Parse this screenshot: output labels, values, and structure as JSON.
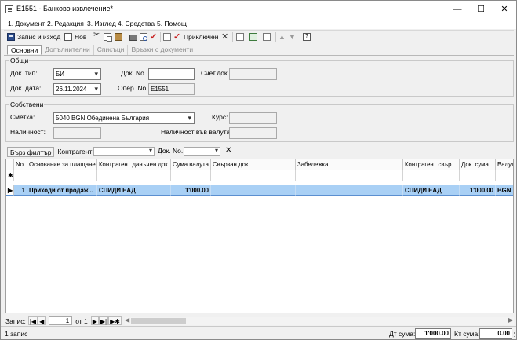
{
  "window": {
    "title": "E1551 - Банково извлечение*",
    "min": "—",
    "max": "☐",
    "close": "✕"
  },
  "menu": [
    "1. Документ",
    "2. Редакция",
    "3. Изглед",
    "4. Средства",
    "5. Помощ"
  ],
  "toolbar": {
    "save_label": "Запис и изход",
    "new_label": "Нов",
    "finish_label": "Приключен"
  },
  "tabs": [
    "Основни",
    "Допълнителни",
    "Списъци",
    "Връзки с документи"
  ],
  "general": {
    "title": "Общи",
    "doc_type_label": "Док. тип:",
    "doc_type_value": "БИ",
    "doc_no_label": "Док. No.",
    "doc_no_value": "",
    "account_doc_label": "Счет.док.",
    "account_doc_value": "",
    "doc_date_label": "Док. дата:",
    "doc_date_value": "26.11.2024",
    "oper_no_label": "Опер. No.",
    "oper_no_value": "E1551"
  },
  "own": {
    "title": "Собствени",
    "account_label": "Сметка:",
    "account_value": "5040 BGN Обединена България",
    "rate_label": "Курс:",
    "rate_value": "",
    "balance_label": "Наличност:",
    "balance_value": "",
    "balance_cur_label": "Наличност във валута:",
    "balance_cur_value": ""
  },
  "filter": {
    "quick_filter": "Бърз филтър",
    "counterparty_label": "Контрагент:",
    "doc_no_label": "Док. No.",
    "clear": "✕"
  },
  "grid": {
    "columns": [
      "No.",
      "Основание за плащане",
      "Контрагент данъчен док.",
      "Сума валута",
      "Свързан док.",
      "Забележка",
      "Контрагент свър...",
      "Док. сума...",
      "Валута"
    ],
    "new_row_marker": "✱",
    "current_row_marker": "▶",
    "rows": [
      {
        "no": "1",
        "reason": "Приходи от продаж...",
        "counterparty": "СПИДИ ЕАД",
        "amount": "1'000.00",
        "linked_doc": "",
        "note": "",
        "counterparty_linked": "СПИДИ ЕАД",
        "doc_amount": "1'000.00",
        "currency": "BGN"
      }
    ]
  },
  "navigator": {
    "label": "Запис:",
    "current": "1",
    "of_label": "от 1"
  },
  "status": {
    "records": "1 запис",
    "debit_label": "Дт сума:",
    "debit_value": "1'000.00",
    "credit_label": "Кт сума:",
    "credit_value": "0.00"
  },
  "icons": [
    "save-icon",
    "new-doc-icon",
    "cut-icon",
    "copy-icon",
    "paste-icon",
    "print-icon",
    "preview-icon",
    "check-icon",
    "delete-icon",
    "doc-icon",
    "refresh-icon",
    "up-icon",
    "down-icon",
    "help-icon"
  ]
}
